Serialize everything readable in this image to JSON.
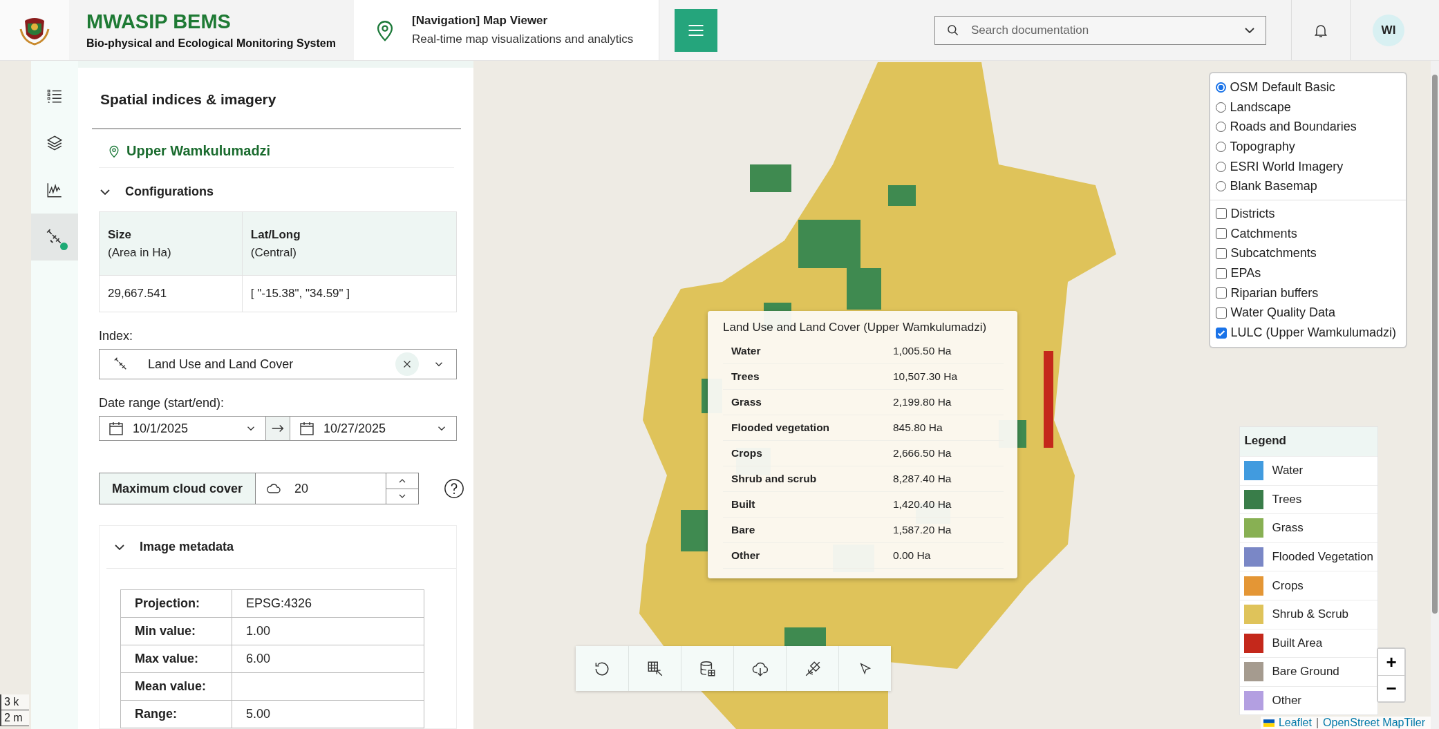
{
  "header": {
    "app_title": "MWASIP BEMS",
    "app_subtitle": "Bio-physical and Ecological Monitoring System",
    "page_title": "[Navigation] Map Viewer",
    "page_subtitle": "Real-time map visualizations and analytics",
    "search": {
      "placeholder": "Search documentation"
    },
    "avatar": "WI"
  },
  "rail": [
    {
      "selected": false
    },
    {
      "selected": false
    },
    {
      "selected": false
    },
    {
      "selected": true
    }
  ],
  "panel": {
    "title": "Spatial indices & imagery",
    "location": "Upper Wamkulumadzi",
    "configurations": {
      "label": "Configurations",
      "expanded": true
    },
    "summary_table": {
      "columns": [
        {
          "label": "Size",
          "sub": "(Area in Ha)"
        },
        {
          "label": "Lat/Long",
          "sub": "(Central)"
        }
      ],
      "row": [
        "29,667.541",
        "[ \"-15.38\", \"34.59\" ]"
      ]
    },
    "index": {
      "label": "Index:",
      "value": "Land Use and Land Cover"
    },
    "date_range": {
      "label": "Date range (start/end):",
      "start": "10/1/2025",
      "end": "10/27/2025"
    },
    "cloud_cover": {
      "label": "Maximum cloud cover",
      "value": "20"
    },
    "metadata": {
      "label": "Image metadata",
      "expanded": true,
      "rows": [
        {
          "label": "Projection:",
          "value": "EPSG:4326"
        },
        {
          "label": "Min value:",
          "value": "1.00"
        },
        {
          "label": "Max value:",
          "value": "6.00"
        },
        {
          "label": "Mean value:"
        },
        {
          "label": "Range:",
          "value": "5.00"
        }
      ]
    }
  },
  "map": {
    "scale": [
      "3 k",
      "2 m"
    ],
    "popup": {
      "title": "Land Use and Land Cover (Upper Wamkulumadzi)",
      "rows": [
        {
          "label": "Water",
          "value": "1,005.50 Ha"
        },
        {
          "label": "Trees",
          "value": "10,507.30 Ha"
        },
        {
          "label": "Grass",
          "value": "2,199.80 Ha"
        },
        {
          "label": "Flooded vegetation",
          "value": "845.80 Ha"
        },
        {
          "label": "Crops",
          "value": "2,666.50 Ha"
        },
        {
          "label": "Shrub and scrub",
          "value": "8,287.40 Ha"
        },
        {
          "label": "Built",
          "value": "1,420.40 Ha"
        },
        {
          "label": "Bare",
          "value": "1,587.20 Ha"
        },
        {
          "label": "Other",
          "value": "0.00 Ha"
        }
      ]
    },
    "layers": {
      "basemaps": [
        {
          "label": "OSM Default Basic",
          "selected": true
        },
        {
          "label": "Landscape",
          "selected": false
        },
        {
          "label": "Roads and Boundaries",
          "selected": false
        },
        {
          "label": "Topography",
          "selected": false
        },
        {
          "label": "ESRI World Imagery",
          "selected": false
        },
        {
          "label": "Blank Basemap",
          "selected": false
        }
      ],
      "overlays": [
        {
          "label": "Districts",
          "checked": false
        },
        {
          "label": "Catchments",
          "checked": false
        },
        {
          "label": "Subcatchments",
          "checked": false
        },
        {
          "label": "EPAs",
          "checked": false
        },
        {
          "label": "Riparian buffers",
          "checked": false
        },
        {
          "label": "Water Quality Data",
          "checked": false
        },
        {
          "label": "LULC (Upper Wamkulumadzi)",
          "checked": true
        }
      ]
    },
    "legend": {
      "title": "Legend",
      "items": [
        {
          "label": "Water",
          "color": "#419bdf"
        },
        {
          "label": "Trees",
          "color": "#397d49"
        },
        {
          "label": "Grass",
          "color": "#88b053"
        },
        {
          "label": "Flooded Vegetation",
          "color": "#7a87c6"
        },
        {
          "label": "Crops",
          "color": "#e49635"
        },
        {
          "label": "Shrub & Scrub",
          "color": "#dfc35a"
        },
        {
          "label": "Built Area",
          "color": "#c4281b"
        },
        {
          "label": "Bare Ground",
          "color": "#a59b8f"
        },
        {
          "label": "Other",
          "color": "#b39fe1"
        }
      ]
    },
    "zoom": {
      "in": "+",
      "out": "−"
    },
    "attribution": {
      "leaflet": "Leaflet",
      "separator": "|",
      "tiles": "OpenStreet MapTiler"
    }
  }
}
